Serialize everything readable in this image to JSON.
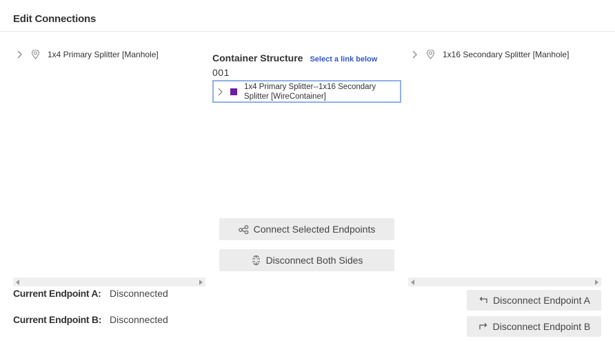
{
  "header": {
    "title": "Edit Connections"
  },
  "left_tree": {
    "item_label": "1x4 Primary Splitter [Manhole]"
  },
  "right_tree": {
    "item_label": "1x16 Secondary Splitter [Manhole]"
  },
  "center": {
    "title": "Container Structure",
    "hint": "Select a link below",
    "code": "001",
    "wire_label": "1x4 Primary Splitter--1x16 Secondary Splitter [WireContainer]",
    "wire_color": "#6b1fa3"
  },
  "buttons": {
    "connect": "Connect Selected Endpoints",
    "disconnect_both": "Disconnect Both Sides",
    "disconnect_a": "Disconnect Endpoint A",
    "disconnect_b": "Disconnect Endpoint B"
  },
  "endpoints": {
    "a_label": "Current Endpoint A:",
    "a_value": "Disconnected",
    "b_label": "Current Endpoint B:",
    "b_value": "Disconnected"
  },
  "icons": {
    "tree_expand": "chevron-right-icon",
    "tree_node": "map-pin-icon",
    "connect": "share-nodes-icon",
    "disconnect_both": "link-break-icon",
    "disconnect_a": "arrow-turn-left-icon",
    "disconnect_b": "arrow-turn-right-icon"
  }
}
